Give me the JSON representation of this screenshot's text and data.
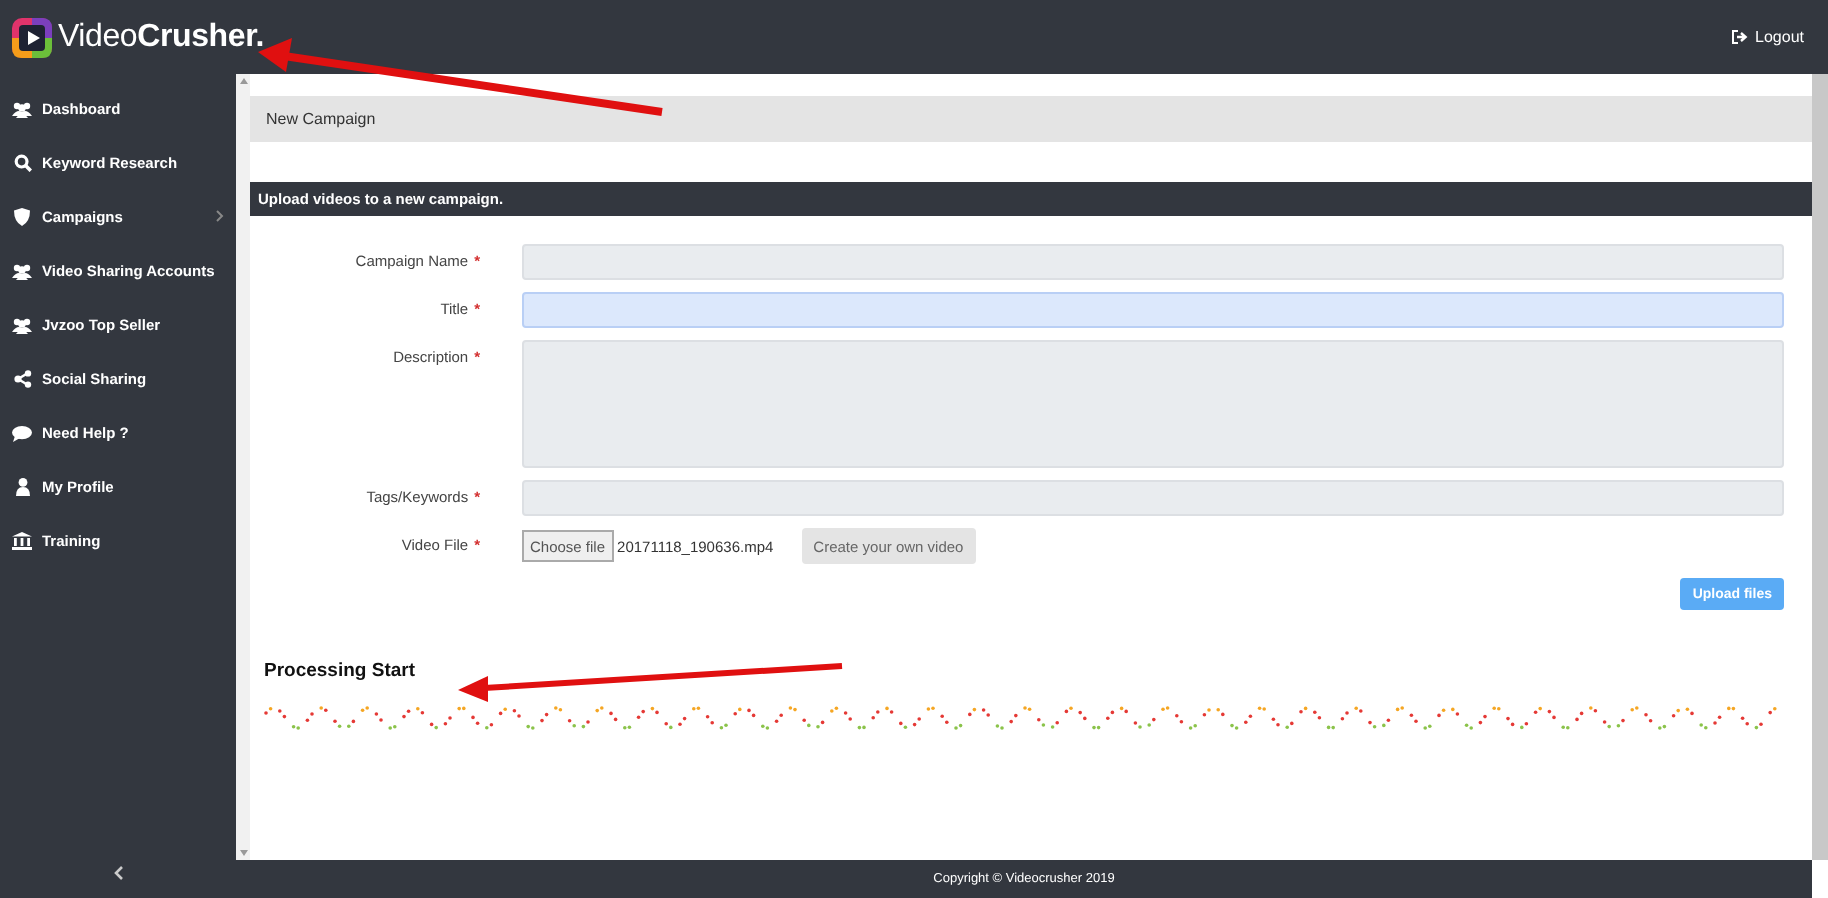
{
  "brand": {
    "name_light": "Video",
    "name_bold": "Crusher."
  },
  "topbar": {
    "logout": "Logout"
  },
  "sidebar": {
    "items": [
      {
        "label": "Dashboard",
        "expandable": false
      },
      {
        "label": "Keyword Research",
        "expandable": false
      },
      {
        "label": "Campaigns",
        "expandable": true
      },
      {
        "label": "Video Sharing Accounts",
        "expandable": false
      },
      {
        "label": "Jvzoo Top Seller",
        "expandable": false
      },
      {
        "label": "Social Sharing",
        "expandable": false
      },
      {
        "label": "Need Help ?",
        "expandable": false
      },
      {
        "label": "My Profile",
        "expandable": false
      },
      {
        "label": "Training",
        "expandable": false
      }
    ]
  },
  "page_title": "New Campaign",
  "section_header": "Upload videos to a new campaign.",
  "form": {
    "fields": [
      {
        "kind": "text",
        "label": "Campaign Name",
        "required_mark": "*",
        "autofilled": false
      },
      {
        "kind": "text",
        "label": "Title",
        "required_mark": "*",
        "autofilled": true
      },
      {
        "kind": "textarea",
        "label": "Description",
        "required_mark": "*",
        "autofilled": false
      },
      {
        "kind": "text",
        "label": "Tags/Keywords",
        "required_mark": "*",
        "autofilled": false
      },
      {
        "kind": "file",
        "label": "Video File",
        "required_mark": "*",
        "button": "Choose file",
        "filename": "20171118_190636.mp4",
        "extra_button": "Create your own video"
      }
    ],
    "submit": "Upload files"
  },
  "processing_title": "Processing Start",
  "footer": "Copyright © Videocrusher 2019"
}
